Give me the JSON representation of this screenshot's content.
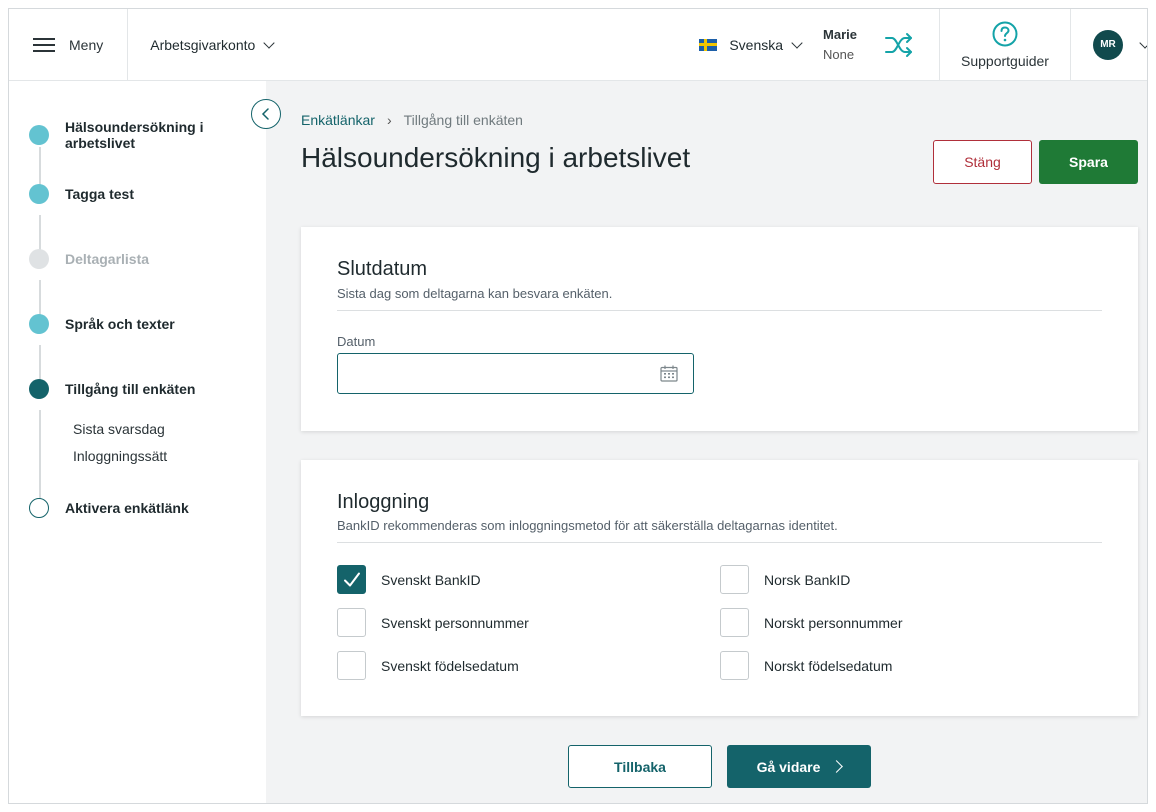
{
  "header": {
    "menu_label": "Meny",
    "account_label": "Arbetsgivarkonto",
    "language": "Svenska",
    "user_name": "Marie",
    "user_sub": "None",
    "support_label": "Supportguider",
    "avatar_initials": "MR"
  },
  "sidebar": {
    "steps": [
      {
        "label": "Hälsoundersökning i arbetslivet",
        "state": "done"
      },
      {
        "label": "Tagga test",
        "state": "done"
      },
      {
        "label": "Deltagarlista",
        "state": "disabled"
      },
      {
        "label": "Språk och texter",
        "state": "done"
      },
      {
        "label": "Tillgång till enkäten",
        "state": "active"
      },
      {
        "label": "Aktivera enkätlänk",
        "state": "empty"
      }
    ],
    "substeps": [
      "Sista svarsdag",
      "Inloggningssätt"
    ]
  },
  "breadcrumb": {
    "link": "Enkätlänkar",
    "current": "Tillgång till enkäten"
  },
  "page": {
    "title": "Hälsoundersökning i arbetslivet",
    "close_label": "Stäng",
    "save_label": "Spara"
  },
  "end_date": {
    "title": "Slutdatum",
    "description": "Sista dag som deltagarna kan besvara enkäten.",
    "field_label": "Datum",
    "value": ""
  },
  "login": {
    "title": "Inloggning",
    "description": "BankID rekommenderas som inloggningsmetod för att säkerställa deltagarnas identitet.",
    "options": [
      {
        "label": "Svenskt BankID",
        "checked": true
      },
      {
        "label": "Norsk BankID",
        "checked": false
      },
      {
        "label": "Svenskt personnummer",
        "checked": false
      },
      {
        "label": "Norskt personnummer",
        "checked": false
      },
      {
        "label": "Svenskt födelsedatum",
        "checked": false
      },
      {
        "label": "Norskt födelsedatum",
        "checked": false
      }
    ]
  },
  "footer": {
    "back_label": "Tillbaka",
    "next_label": "Gå vidare"
  },
  "colors": {
    "primary": "#14636a",
    "save": "#1f7a36",
    "danger": "#b02f3a",
    "step_done": "#63c3d1"
  }
}
